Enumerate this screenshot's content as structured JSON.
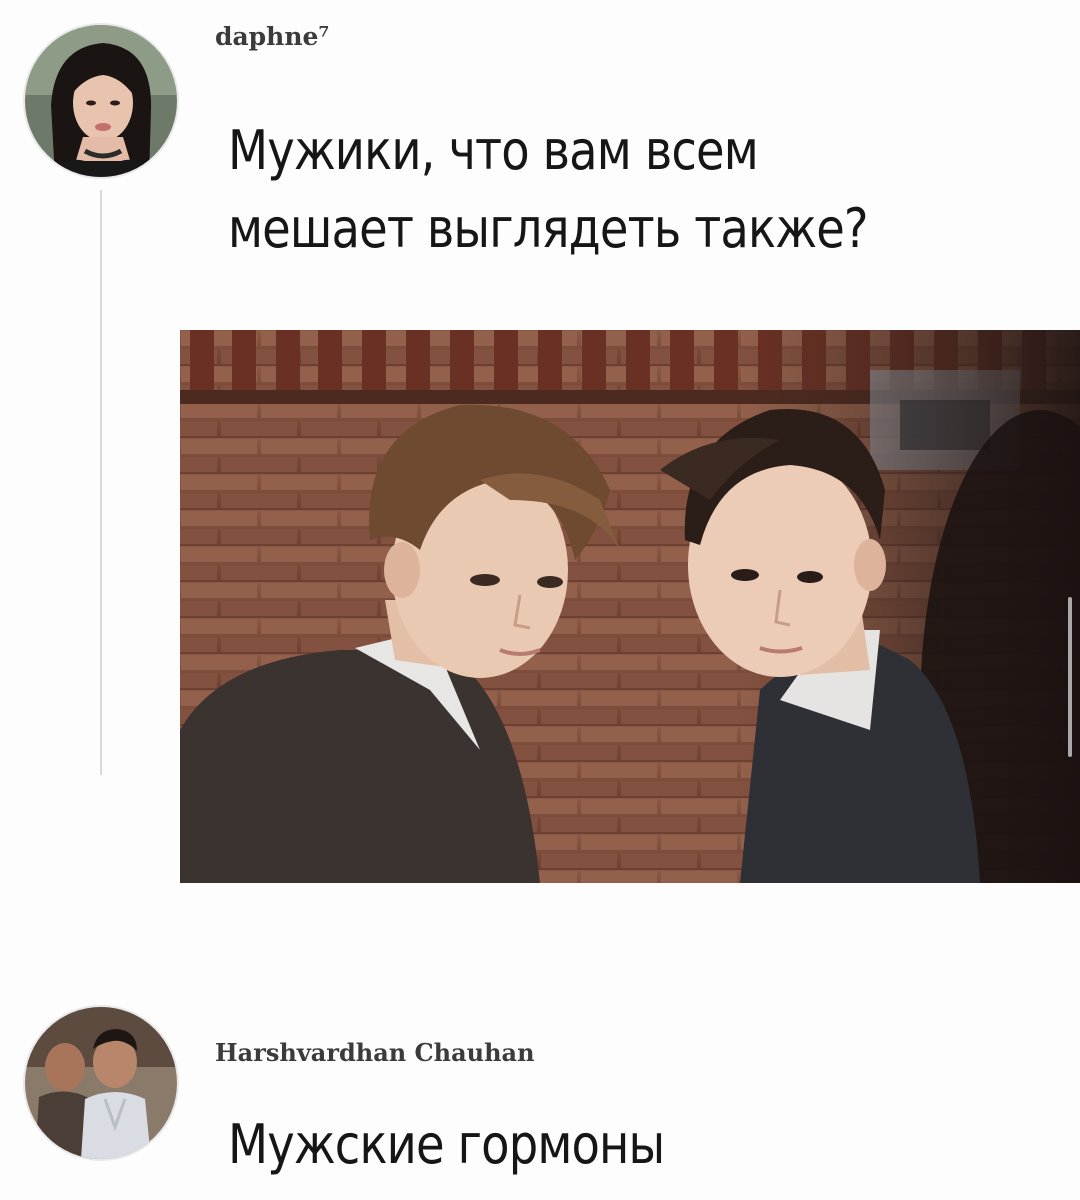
{
  "thread": {
    "posts": [
      {
        "username": "daphne⁷",
        "text": "Мужики, что вам всем мешает выглядеть также?",
        "avatar_icon": "user-avatar-woman-icon",
        "image_icon": "photo-two-men-brick-wall"
      },
      {
        "username": "Harshvardhan Chauhan",
        "text": "Мужские гормоны",
        "avatar_icon": "user-avatar-man-icon"
      }
    ]
  },
  "colors": {
    "background": "#fdfdfd",
    "text": "#161616",
    "username": "#3b3b3b",
    "thread_line": "#d9d9d9",
    "scrollbar": "#a9a9a9"
  }
}
